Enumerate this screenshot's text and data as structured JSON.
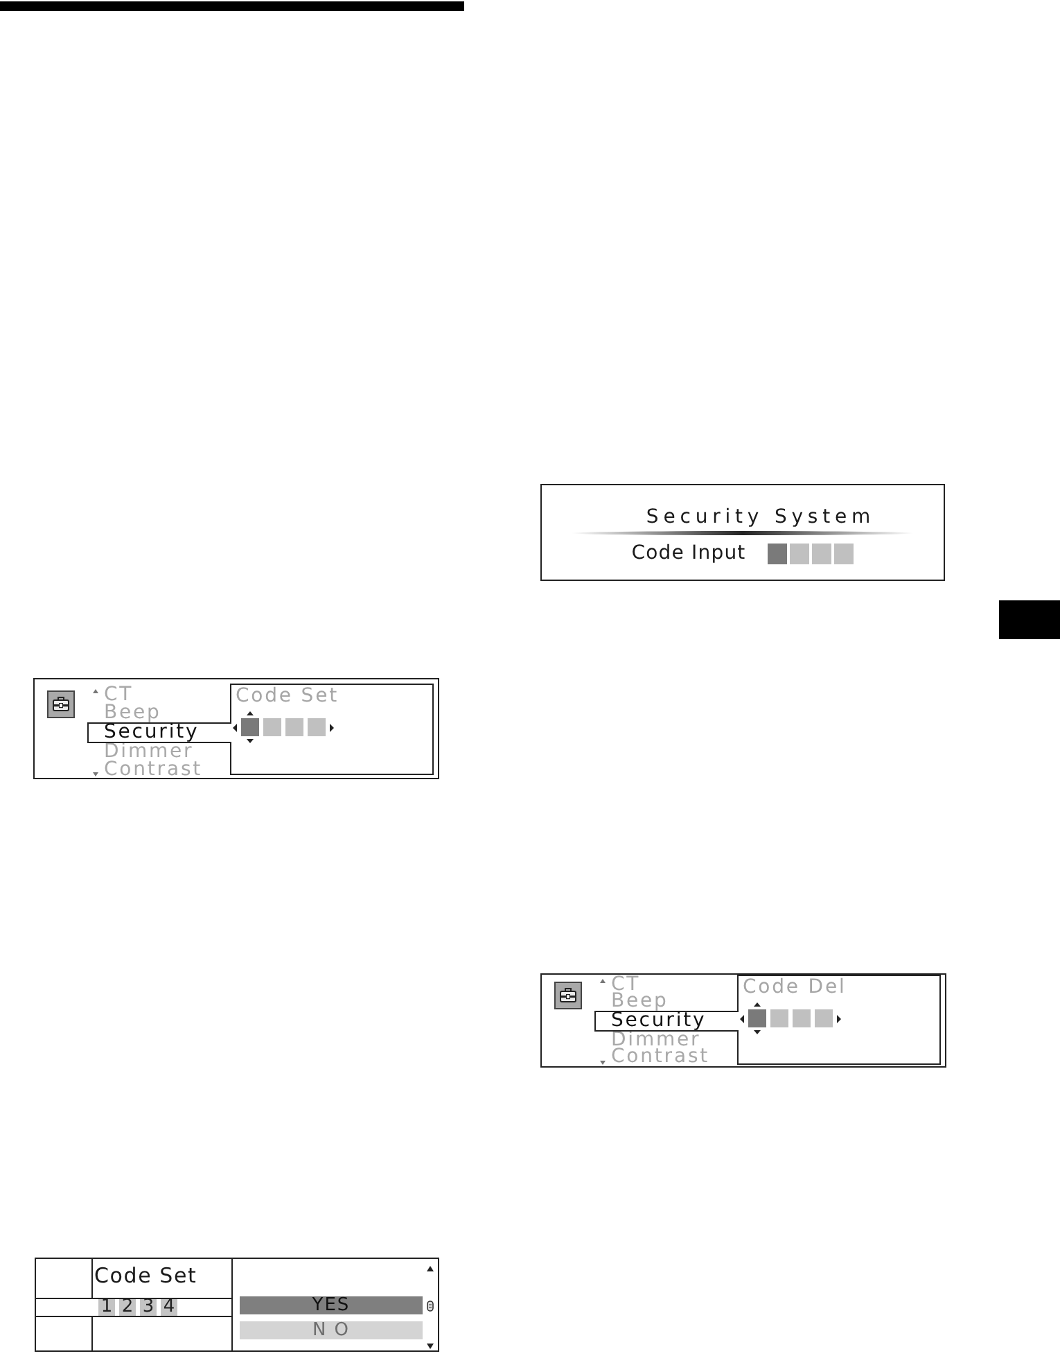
{
  "columns": [
    {
      "displays": [
        {
          "kind": "menu",
          "menu": [
            {
              "label": "CT",
              "selected": false
            },
            {
              "label": "Beep",
              "selected": false
            },
            {
              "label": "Security",
              "selected": true
            },
            {
              "label": "Dimmer",
              "selected": false
            },
            {
              "label": "Contrast",
              "selected": false
            }
          ],
          "panel_title": "Code Set",
          "code": [
            {
              "selected": true
            },
            {
              "selected": false
            },
            {
              "selected": false
            },
            {
              "selected": false
            }
          ]
        },
        {
          "kind": "confirm",
          "title": "Code Set",
          "digits": [
            "1",
            "2",
            "3",
            "4"
          ],
          "options": [
            {
              "label": "YES",
              "selected": true
            },
            {
              "label": "N O",
              "selected": false
            }
          ]
        }
      ]
    },
    {
      "displays": [
        {
          "kind": "prompt",
          "title": "Security System",
          "label": "Code Input",
          "code": [
            {
              "selected": true
            },
            {
              "selected": false
            },
            {
              "selected": false
            },
            {
              "selected": false
            }
          ]
        },
        {
          "kind": "menu",
          "menu": [
            {
              "label": "CT",
              "selected": false
            },
            {
              "label": "Beep",
              "selected": false
            },
            {
              "label": "Security",
              "selected": true
            },
            {
              "label": "Dimmer",
              "selected": false
            },
            {
              "label": "Contrast",
              "selected": false
            }
          ],
          "panel_title": "Code Del",
          "code": [
            {
              "selected": true
            },
            {
              "selected": false
            },
            {
              "selected": false
            },
            {
              "selected": false
            }
          ]
        }
      ]
    }
  ]
}
